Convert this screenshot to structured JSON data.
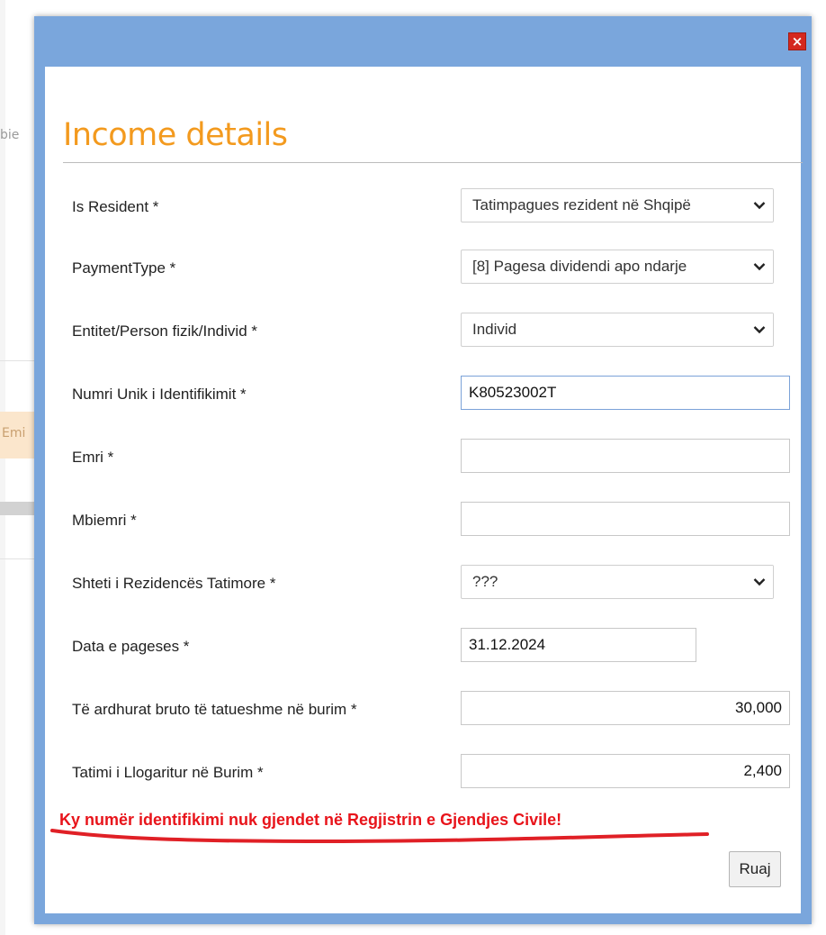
{
  "background": {
    "fragment_top": "bie",
    "fragment_mid": "Emi"
  },
  "dialog": {
    "close_glyph": "×",
    "title": "Income details",
    "fields": [
      {
        "label": "Is Resident *",
        "value": "Tatimpagues rezident në Shqipë",
        "type": "select"
      },
      {
        "label": "PaymentType *",
        "value": "[8] Pagesa dividendi apo ndarje",
        "type": "select"
      },
      {
        "label": "Entitet/Person fizik/Individ *",
        "value": "Individ",
        "type": "select"
      },
      {
        "label": "Numri Unik i Identifikimit *",
        "value": "K80523002T",
        "type": "input"
      },
      {
        "label": "Emri *",
        "value": "",
        "type": "input"
      },
      {
        "label": "Mbiemri *",
        "value": "",
        "type": "input"
      },
      {
        "label": "Shteti i Rezidencës Tatimore *",
        "value": "???",
        "type": "select"
      },
      {
        "label": "Data e pageses *",
        "value": "31.12.2024",
        "type": "input"
      },
      {
        "label": "Të ardhurat bruto të tatueshme në burim *",
        "value": "30,000",
        "type": "input"
      },
      {
        "label": "Tatimi i Llogaritur në Burim *",
        "value": "2,400",
        "type": "input"
      }
    ],
    "error_message": "Ky numër identifikimi nuk gjendet në Regjistrin e Gjendjes Civile!",
    "save_label": "Ruaj"
  },
  "colors": {
    "dialog_border": "#7aa6dc",
    "title": "#f39a1e",
    "close_button": "#d4281e",
    "error": "#e8141b"
  }
}
